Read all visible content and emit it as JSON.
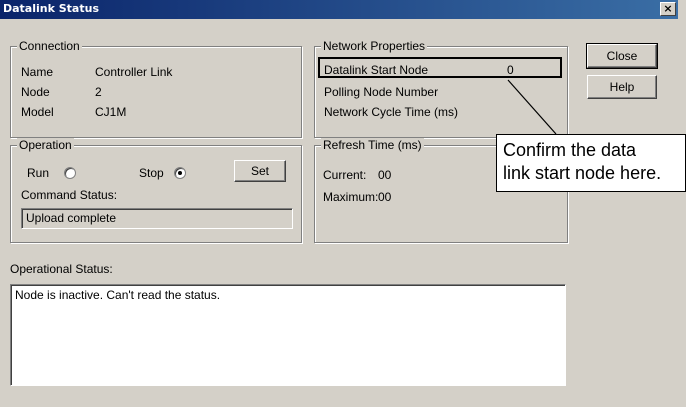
{
  "window": {
    "title": "Datalink Status",
    "close_glyph": "×"
  },
  "connection": {
    "legend": "Connection",
    "rows": [
      {
        "label": "Name",
        "value": "Controller Link"
      },
      {
        "label": "Node",
        "value": "2"
      },
      {
        "label": "Model",
        "value": "CJ1M"
      }
    ]
  },
  "network": {
    "legend": "Network Properties",
    "start_node_label": "Datalink Start Node",
    "start_node_value": "0",
    "polling_label": "Polling Node Number",
    "cycle_label": "Network Cycle Time (ms)"
  },
  "operation": {
    "legend": "Operation",
    "run_label": "Run",
    "stop_label": "Stop",
    "selected": "stop",
    "set_label": "Set",
    "command_status_label": "Command Status:",
    "command_status_value": "Upload complete"
  },
  "refresh": {
    "legend": "Refresh Time (ms)",
    "current_label": "Current:",
    "current_value": "00",
    "maximum_label": "Maximum:",
    "maximum_value": "00"
  },
  "buttons": {
    "close": "Close",
    "help": "Help"
  },
  "operational_status": {
    "label": "Operational Status:",
    "text": "Node is inactive. Can't read the status."
  },
  "callout": {
    "line1": "Confirm the data",
    "line2": "link start node here."
  }
}
